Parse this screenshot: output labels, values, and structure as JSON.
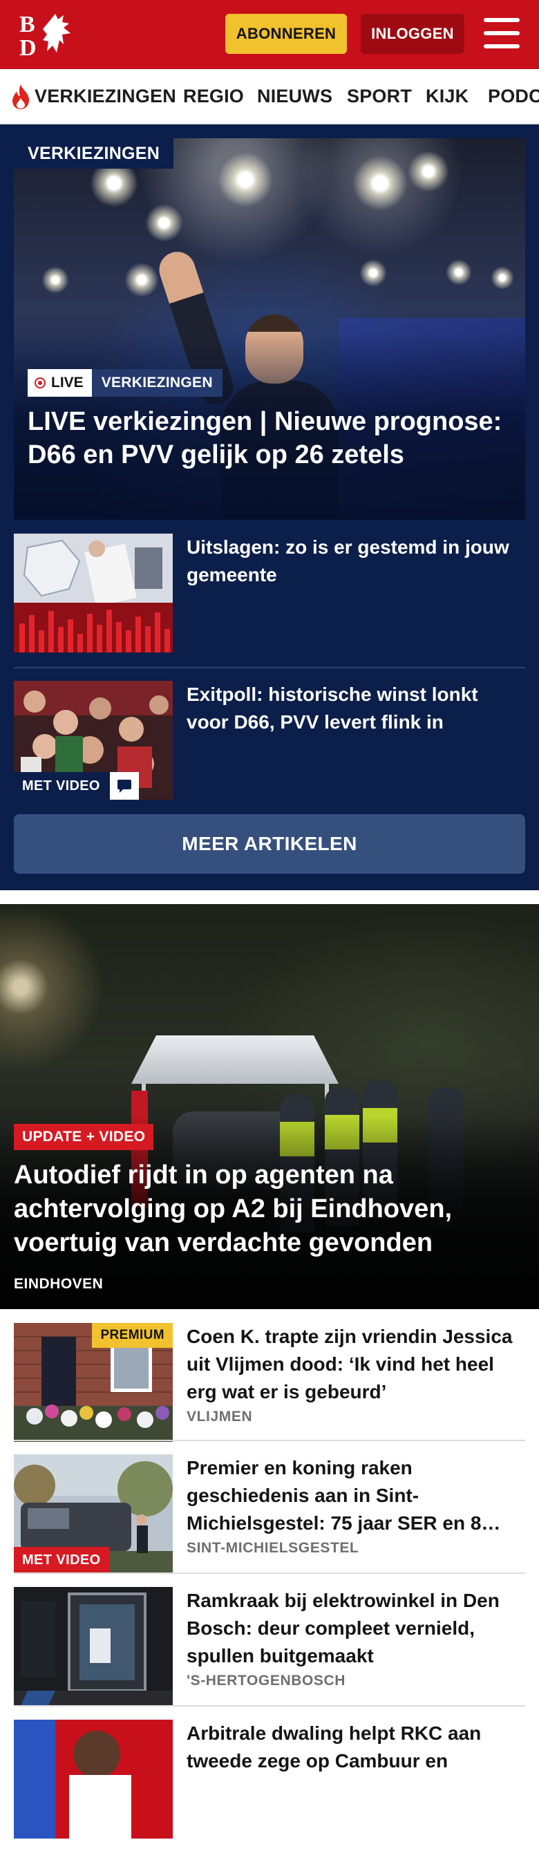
{
  "header": {
    "subscribe_label": "ABONNEREN",
    "login_label": "INLOGGEN",
    "logo_letters": "BD",
    "brand_color": "#c8101b"
  },
  "nav": {
    "items": [
      "VERKIEZINGEN",
      "REGIO",
      "NIEUWS",
      "SPORT",
      "KIJK",
      "PODC"
    ]
  },
  "verkiezingen": {
    "section_label": "VERKIEZINGEN",
    "hero": {
      "live_label": "LIVE",
      "category_label": "VERKIEZINGEN",
      "title": "LIVE verkiezingen | Nieuwe prognose: D66 en PVV gelijk op 26 zetels"
    },
    "items": [
      {
        "title": "Uitslagen: zo is er gestemd in jouw gemeente"
      },
      {
        "title": "Exitpoll: historische winst lonkt voor D66, PVV levert flink in",
        "badge": "MET VIDEO"
      }
    ],
    "more_label": "MEER ARTIKELEN"
  },
  "hero2": {
    "badge": "UPDATE + VIDEO",
    "title": "Autodief rijdt in op agenten na achtervolging op A2 bij Eindhoven, voertuig van verdachte gevonden",
    "location": "EINDHOVEN"
  },
  "articles": [
    {
      "title": "Coen K. trapte zijn vriendin Jessica uit Vlijmen dood: ‘Ik vind het heel erg wat er is gebeurd’",
      "location": "VLIJMEN",
      "badge": "PREMIUM"
    },
    {
      "title": "Premier en koning raken geschiedenis aan in Sint-Michielsgestel: 75 jaar SER en 8…",
      "location": "SINT-MICHIELSGESTEL",
      "badge": "MET VIDEO"
    },
    {
      "title": "Ramkraak bij elektrowinkel in Den Bosch: deur compleet vernield, spullen buitgemaakt",
      "location": "'S-HERTOGENBOSCH"
    },
    {
      "title": "Arbitrale dwaling helpt RKC aan tweede zege op Cambuur en"
    }
  ]
}
